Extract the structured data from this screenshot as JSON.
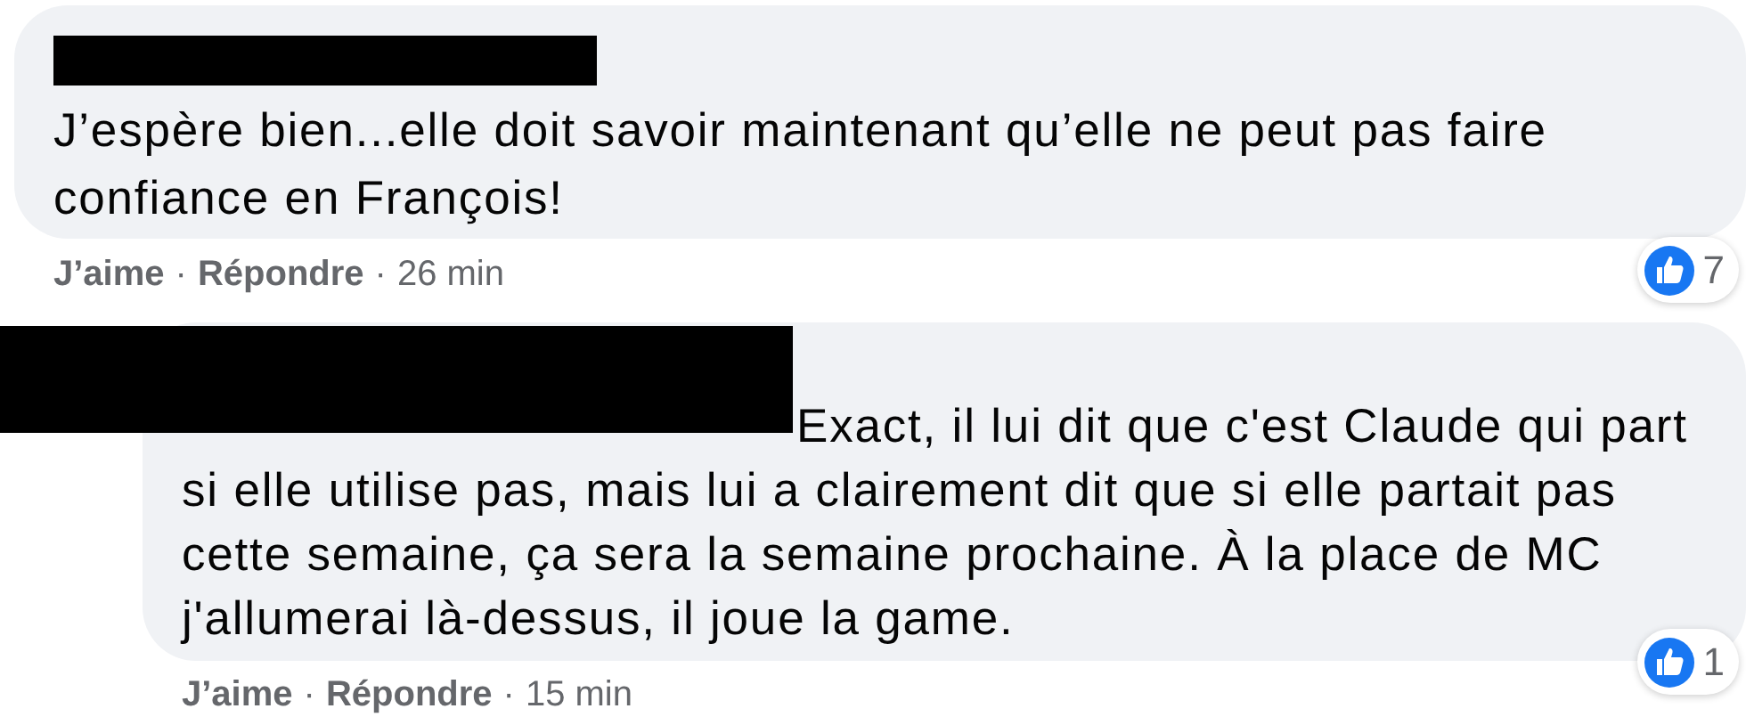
{
  "comments": [
    {
      "redacted": true,
      "text": "J’espère bien...elle doit savoir maintenant qu’elle ne peut pas faire confiance en François!",
      "like": "J’aime",
      "separator": "·",
      "reply": "Répondre",
      "time": "26 min",
      "reactions": "7"
    },
    {
      "redacted": true,
      "text": "Exact, il lui dit que c'est Claude qui part si elle utilise pas, mais lui a clairement dit que si elle partait pas cette semaine, ça sera la semaine prochaine. À la place de MC j'allumerai là-dessus, il joue la game.",
      "like": "J’aime",
      "separator": "·",
      "reply": "Répondre",
      "time": "15 min",
      "reactions": "1"
    }
  ]
}
